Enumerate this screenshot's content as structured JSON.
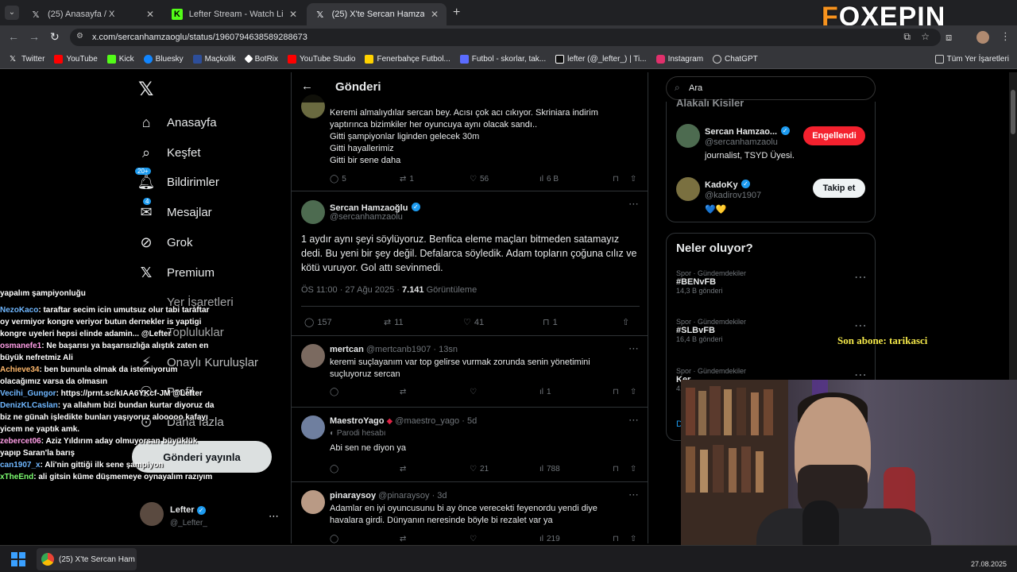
{
  "tabs": [
    {
      "title": "(25) Anasayfa / X"
    },
    {
      "title": "Lefter Stream - Watch Live on K"
    },
    {
      "title": "(25) X'te Sercan Hamzaoğlu: \""
    }
  ],
  "address": {
    "url": "x.com/sercanhamzaoglu/status/1960794638589288673"
  },
  "bookmarks": [
    "Twitter",
    "YouTube",
    "Kick",
    "Bluesky",
    "Maçkolik",
    "BotRix",
    "YouTube Studio",
    "Fenerbahçe Futbol...",
    "Futbol - skorlar, tak...",
    "lefter (@_lefter_) | Ti...",
    "Instagram",
    "ChatGPT"
  ],
  "bookmarks_all": "Tüm Yer İşaretleri",
  "logo": {
    "first": "F",
    "rest": "OXEPIN"
  },
  "nav": {
    "home": "Anasayfa",
    "explore": "Keşfet",
    "notifications": "Bildirimler",
    "notif_badge": "20+",
    "messages": "Mesajlar",
    "msg_badge": "4",
    "grok": "Grok",
    "premium": "Premium",
    "bookmarks": "Yer İşaretleri",
    "communities": "Topluluklar",
    "verified_orgs": "Onaylı Kuruluşlar",
    "profile": "Profil",
    "more": "Daha fazla",
    "post_button": "Gönderi yayınla",
    "account_name": "Lefter",
    "account_handle": "@_Lefter_"
  },
  "chat": [
    {
      "user": "",
      "msg": "yapalım şampiyonluğu"
    },
    {
      "user": "NezoKaco",
      "msg": ": taraftar secim icin umutsuz olur tabi taraftar oy vermiyor kongre veriyor butun dernekler is yaptigi kongre uyeleri hepsi elinde adamin... @Lefter"
    },
    {
      "user": "osmanefe1",
      "msg": ": Ne başarısı ya başarısızlığa alıştık zaten en büyük nefretmiz Ali"
    },
    {
      "user": "Achieve34",
      "msg": ": ben bununla olmak da istemiyorum olacağımız varsa da olmasın"
    },
    {
      "user": "Vecihi_Gungor",
      "msg": ": https://prnt.sc/kIAA6YKcf-JM @Lefter"
    },
    {
      "user": "DenizKLCaslan",
      "msg": ": ya allahım bizi bundan kurtar diyoruz da biz ne günah işledikte bunları yaşıyoruz alooooo kafayı yicem ne yaptık amk."
    },
    {
      "user": "zebercet06",
      "msg": ": Aziz Yıldırım aday olmuyorsan büyüklük yapıp Saran'la barış"
    },
    {
      "user": "can1907_x",
      "msg": ": Ali'nin gittiği ilk sene şampiyon"
    },
    {
      "user": "xTheEnd",
      "msg": ": ali gitsin küme düşmemeye oynayalım razıyım"
    }
  ],
  "header": {
    "title": "Gönderi"
  },
  "prev_tweet": {
    "lines": [
      "Keremi almalıydılar sercan bey. Acısı çok acı cıkıyor. Skriniara indirim",
      "yaptırınca bizimkiler her oyuncuya aynı olacak sandı..",
      "Gitti şampiyonlar liginden gelecek 30m",
      "Gitti hayallerimiz",
      "Gitti bir sene daha"
    ],
    "replies": "5",
    "reposts": "1",
    "likes": "56",
    "views": "6 B"
  },
  "main_tweet": {
    "name": "Sercan Hamzaoğlu",
    "handle": "@sercanhamzaolu",
    "text": "1 aydır aynı şeyi söylüyoruz. Benfica eleme maçları bitmeden satamayız dedi. Bu yeni bir şey değil. Defalarca söyledik. Adam topların çoğuna cılız ve kötü vuruyor. Gol attı sevinmedi.",
    "time": "ÖS 11:00 · 27 Ağu 2025 ·",
    "views_count": "7.141",
    "views_label": "Görüntüleme",
    "replies": "157",
    "reposts": "11",
    "likes": "41",
    "bookmarks": "1"
  },
  "replies": [
    {
      "name": "mertcan",
      "handle": "@mertcanb1907 · 13sn",
      "tag": "",
      "text": "keremi suçlayanım var top gelirse vurmak zorunda senin yönetimini suçluyoruz sercan",
      "likes": "",
      "views": "1"
    },
    {
      "name": "MaestroYago",
      "handle": "@maestro_yago · 5d",
      "tag": "Parodi hesabı",
      "text": "Abi sen ne diyon ya",
      "likes": "21",
      "views": "788"
    },
    {
      "name": "pinaraysoy",
      "handle": "@pinaraysoy · 3d",
      "tag": "",
      "text": "Adamlar en iyi oyuncusunu bi ay önce verecekti feyenordu yendi diye havalara girdi. Dünyanın neresinde böyle bi rezalet var ya",
      "likes": "",
      "views": "219"
    }
  ],
  "search": {
    "placeholder": "Ara"
  },
  "related": {
    "title": "Alakalı Kişiler",
    "people": [
      {
        "name": "Sercan Hamzao...",
        "handle": "@sercanhamzaolu",
        "bio": "journalist, TSYD Üyesi.",
        "button": "Engellendi"
      },
      {
        "name": "KadoKy",
        "handle": "@kadirov1907",
        "bio": "💙💛",
        "button": "Takip et"
      }
    ]
  },
  "trends": {
    "title": "Neler oluyor?",
    "items": [
      {
        "category": "Spor · Gündemdekiler",
        "tag": "#BENvFB",
        "count": "14,3 B gönderi"
      },
      {
        "category": "Spor · Gündemdekiler",
        "tag": "#SLBvFB",
        "count": "16,4 B gönderi"
      },
      {
        "category": "Spor · Gündemdekiler",
        "tag": "Ker",
        "count": "41"
      }
    ],
    "more": "D"
  },
  "sub_alert": "Son abone: tarikasci",
  "taskbar": {
    "app": "(25) X'te Sercan Hamzao",
    "date": "27.08.2025"
  },
  "colors": {
    "accent": "#1d9bf0",
    "blocked": "#f4212e",
    "alert": "#f5e94a"
  }
}
